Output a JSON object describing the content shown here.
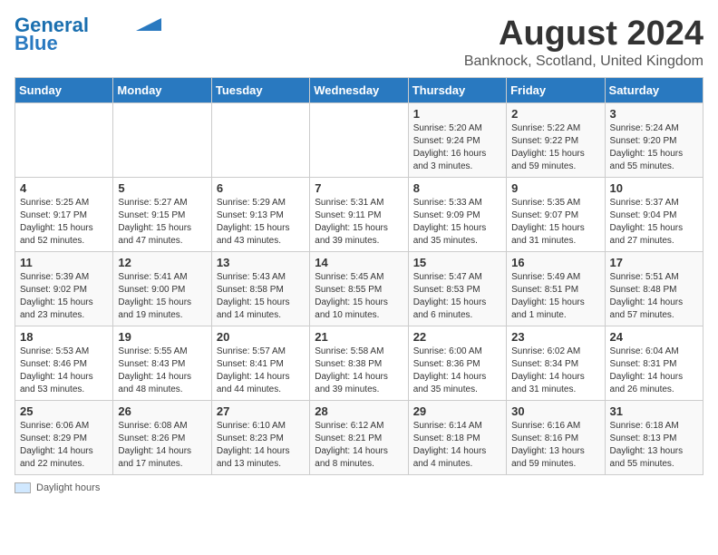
{
  "logo": {
    "line1": "General",
    "line2": "Blue"
  },
  "title": "August 2024",
  "subtitle": "Banknock, Scotland, United Kingdom",
  "days_of_week": [
    "Sunday",
    "Monday",
    "Tuesday",
    "Wednesday",
    "Thursday",
    "Friday",
    "Saturday"
  ],
  "footer": {
    "legend_label": "Daylight hours"
  },
  "weeks": [
    [
      {
        "day": "",
        "info": ""
      },
      {
        "day": "",
        "info": ""
      },
      {
        "day": "",
        "info": ""
      },
      {
        "day": "",
        "info": ""
      },
      {
        "day": "1",
        "info": "Sunrise: 5:20 AM\nSunset: 9:24 PM\nDaylight: 16 hours\nand 3 minutes."
      },
      {
        "day": "2",
        "info": "Sunrise: 5:22 AM\nSunset: 9:22 PM\nDaylight: 15 hours\nand 59 minutes."
      },
      {
        "day": "3",
        "info": "Sunrise: 5:24 AM\nSunset: 9:20 PM\nDaylight: 15 hours\nand 55 minutes."
      }
    ],
    [
      {
        "day": "4",
        "info": "Sunrise: 5:25 AM\nSunset: 9:17 PM\nDaylight: 15 hours\nand 52 minutes."
      },
      {
        "day": "5",
        "info": "Sunrise: 5:27 AM\nSunset: 9:15 PM\nDaylight: 15 hours\nand 47 minutes."
      },
      {
        "day": "6",
        "info": "Sunrise: 5:29 AM\nSunset: 9:13 PM\nDaylight: 15 hours\nand 43 minutes."
      },
      {
        "day": "7",
        "info": "Sunrise: 5:31 AM\nSunset: 9:11 PM\nDaylight: 15 hours\nand 39 minutes."
      },
      {
        "day": "8",
        "info": "Sunrise: 5:33 AM\nSunset: 9:09 PM\nDaylight: 15 hours\nand 35 minutes."
      },
      {
        "day": "9",
        "info": "Sunrise: 5:35 AM\nSunset: 9:07 PM\nDaylight: 15 hours\nand 31 minutes."
      },
      {
        "day": "10",
        "info": "Sunrise: 5:37 AM\nSunset: 9:04 PM\nDaylight: 15 hours\nand 27 minutes."
      }
    ],
    [
      {
        "day": "11",
        "info": "Sunrise: 5:39 AM\nSunset: 9:02 PM\nDaylight: 15 hours\nand 23 minutes."
      },
      {
        "day": "12",
        "info": "Sunrise: 5:41 AM\nSunset: 9:00 PM\nDaylight: 15 hours\nand 19 minutes."
      },
      {
        "day": "13",
        "info": "Sunrise: 5:43 AM\nSunset: 8:58 PM\nDaylight: 15 hours\nand 14 minutes."
      },
      {
        "day": "14",
        "info": "Sunrise: 5:45 AM\nSunset: 8:55 PM\nDaylight: 15 hours\nand 10 minutes."
      },
      {
        "day": "15",
        "info": "Sunrise: 5:47 AM\nSunset: 8:53 PM\nDaylight: 15 hours\nand 6 minutes."
      },
      {
        "day": "16",
        "info": "Sunrise: 5:49 AM\nSunset: 8:51 PM\nDaylight: 15 hours\nand 1 minute."
      },
      {
        "day": "17",
        "info": "Sunrise: 5:51 AM\nSunset: 8:48 PM\nDaylight: 14 hours\nand 57 minutes."
      }
    ],
    [
      {
        "day": "18",
        "info": "Sunrise: 5:53 AM\nSunset: 8:46 PM\nDaylight: 14 hours\nand 53 minutes."
      },
      {
        "day": "19",
        "info": "Sunrise: 5:55 AM\nSunset: 8:43 PM\nDaylight: 14 hours\nand 48 minutes."
      },
      {
        "day": "20",
        "info": "Sunrise: 5:57 AM\nSunset: 8:41 PM\nDaylight: 14 hours\nand 44 minutes."
      },
      {
        "day": "21",
        "info": "Sunrise: 5:58 AM\nSunset: 8:38 PM\nDaylight: 14 hours\nand 39 minutes."
      },
      {
        "day": "22",
        "info": "Sunrise: 6:00 AM\nSunset: 8:36 PM\nDaylight: 14 hours\nand 35 minutes."
      },
      {
        "day": "23",
        "info": "Sunrise: 6:02 AM\nSunset: 8:34 PM\nDaylight: 14 hours\nand 31 minutes."
      },
      {
        "day": "24",
        "info": "Sunrise: 6:04 AM\nSunset: 8:31 PM\nDaylight: 14 hours\nand 26 minutes."
      }
    ],
    [
      {
        "day": "25",
        "info": "Sunrise: 6:06 AM\nSunset: 8:29 PM\nDaylight: 14 hours\nand 22 minutes."
      },
      {
        "day": "26",
        "info": "Sunrise: 6:08 AM\nSunset: 8:26 PM\nDaylight: 14 hours\nand 17 minutes."
      },
      {
        "day": "27",
        "info": "Sunrise: 6:10 AM\nSunset: 8:23 PM\nDaylight: 14 hours\nand 13 minutes."
      },
      {
        "day": "28",
        "info": "Sunrise: 6:12 AM\nSunset: 8:21 PM\nDaylight: 14 hours\nand 8 minutes."
      },
      {
        "day": "29",
        "info": "Sunrise: 6:14 AM\nSunset: 8:18 PM\nDaylight: 14 hours\nand 4 minutes."
      },
      {
        "day": "30",
        "info": "Sunrise: 6:16 AM\nSunset: 8:16 PM\nDaylight: 13 hours\nand 59 minutes."
      },
      {
        "day": "31",
        "info": "Sunrise: 6:18 AM\nSunset: 8:13 PM\nDaylight: 13 hours\nand 55 minutes."
      }
    ]
  ]
}
